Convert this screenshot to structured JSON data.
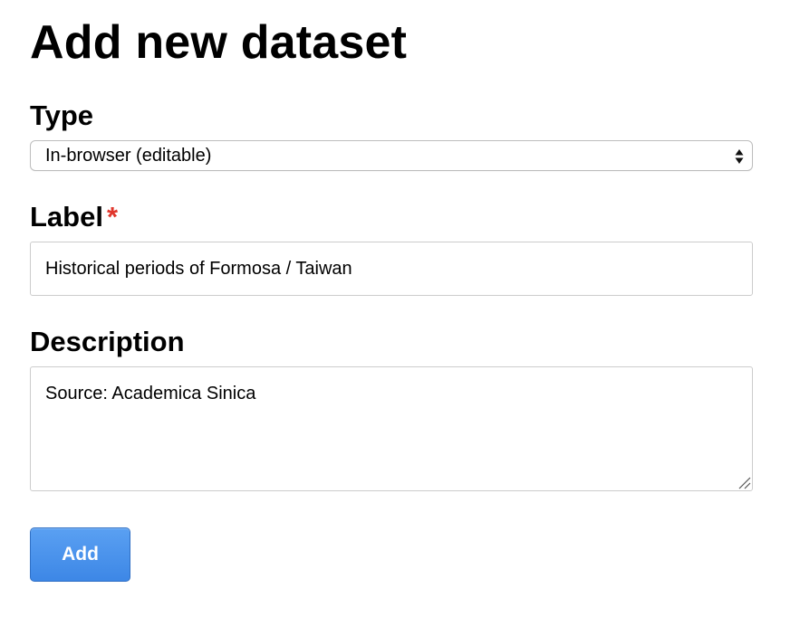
{
  "page": {
    "title": "Add new dataset"
  },
  "form": {
    "type": {
      "label": "Type",
      "selected": "In-browser (editable)"
    },
    "label_field": {
      "label": "Label",
      "required_marker": "*",
      "value": "Historical periods of Formosa / Taiwan"
    },
    "description": {
      "label": "Description",
      "value": "Source: Academica Sinica"
    },
    "submit": {
      "label": "Add"
    }
  },
  "icons": {
    "select_arrows": "select-updown-icon",
    "textarea_grip": "resize-grip-icon"
  },
  "colors": {
    "required": "#e0362c",
    "button_bg": "#4a93ec",
    "button_border": "#2f6fc4",
    "input_border": "#cccccc"
  }
}
